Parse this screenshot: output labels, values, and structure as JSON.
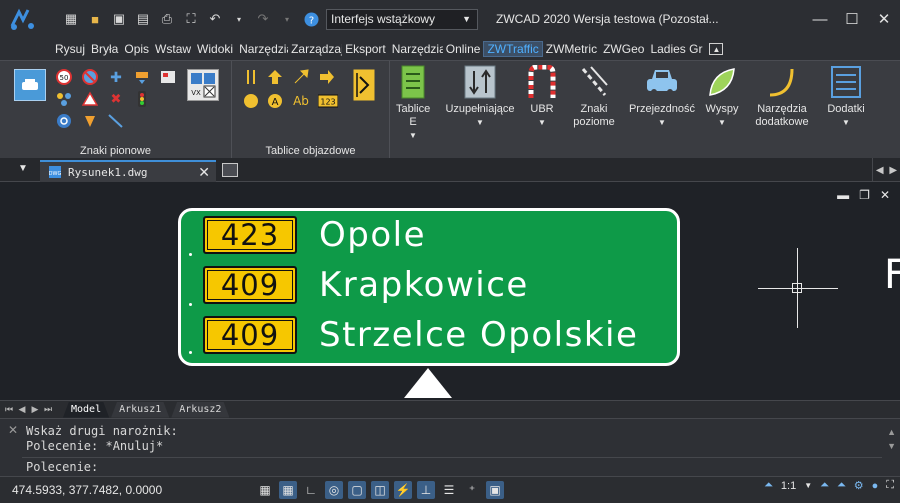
{
  "titlebar": {
    "workspace": "Interfejs wstążkowy",
    "title": "ZWCAD 2020 Wersja testowa (Pozostał..."
  },
  "menu": {
    "items": [
      "Rysuj",
      "Bryła",
      "Opis",
      "Wstaw",
      "Widoki",
      "Narzędzia",
      "Zarządzaj",
      "Eksport",
      "Narzędzia",
      "Online",
      "ZWTraffic",
      "ZWMetric",
      "ZWGeo",
      "Ladies Gr"
    ],
    "active_index": 10
  },
  "ribbon": {
    "panel_znaki": "Znaki pionowe",
    "panel_objazd": "Tablice objazdowe",
    "big_buttons": [
      "Tablice E",
      "Uzupełniające",
      "UBR",
      "Znaki poziome",
      "Przejezdność",
      "Wyspy",
      "Narzędzia dodatkowe",
      "Dodatki"
    ],
    "small_labels": {
      "speed": "50",
      "ab": "Ab",
      "num": "123",
      "vx": "VX"
    }
  },
  "document": {
    "tab_label": "Rysunek1.dwg"
  },
  "sign": {
    "rows": [
      {
        "number": "423",
        "destination": "Opole"
      },
      {
        "number": "409",
        "destination": "Krapkowice"
      },
      {
        "number": "409",
        "destination": "Strzelce Opolskie"
      }
    ],
    "cut_text": "F"
  },
  "layouts": {
    "tabs": [
      "Model",
      "Arkusz1",
      "Arkusz2"
    ]
  },
  "command": {
    "lines": [
      "Wskaż drugi narożnik:",
      "Polecenie: *Anuluj*",
      "Polecenie:"
    ]
  },
  "status": {
    "coords": "474.5933, 377.7482, 0.0000",
    "scale": "1:1"
  },
  "colors": {
    "sign_green": "#0e9a48",
    "route_yellow": "#f6c700",
    "active_menu": "#4fb0ff"
  }
}
